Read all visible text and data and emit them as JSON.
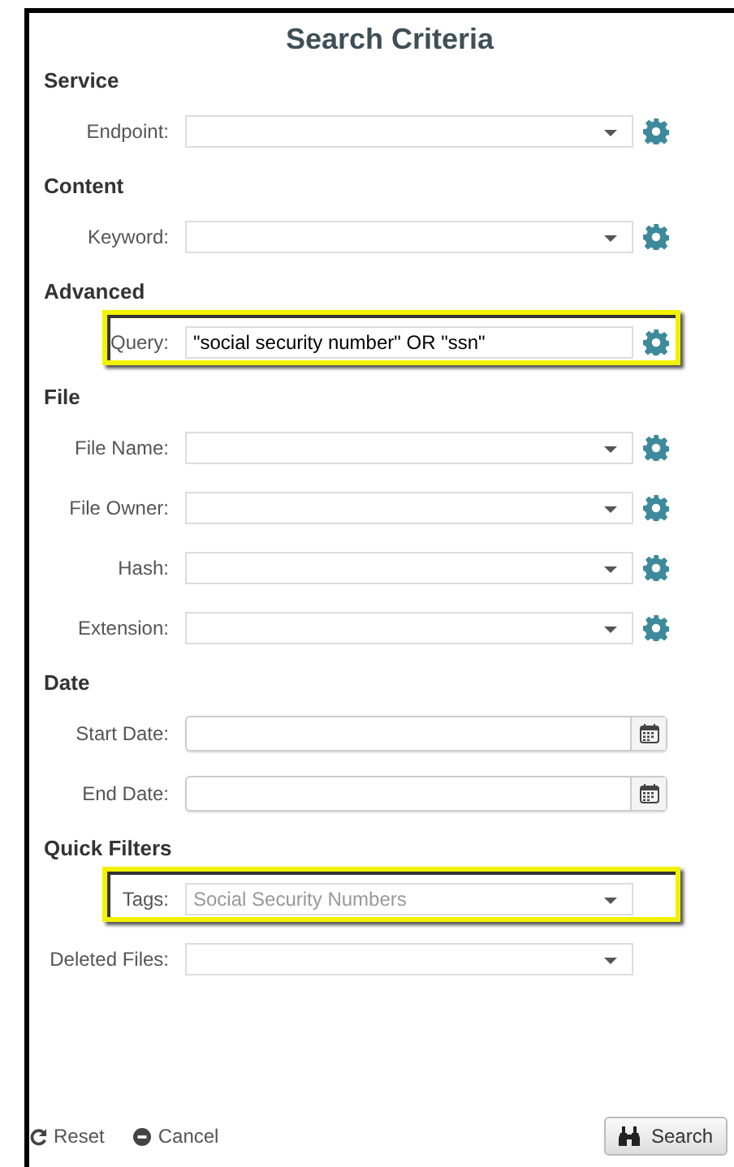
{
  "title": "Search Criteria",
  "sections": [
    {
      "heading": "Service",
      "fields": [
        {
          "kind": "combo",
          "label": "Endpoint:",
          "highlighted": false
        }
      ]
    },
    {
      "heading": "Content",
      "fields": [
        {
          "kind": "combo",
          "label": "Keyword:",
          "highlighted": false
        }
      ]
    },
    {
      "heading": "Advanced",
      "fields": [
        {
          "kind": "text",
          "label": "Query:",
          "value": "\"social security number\" OR \"ssn\"",
          "highlighted": true
        }
      ]
    },
    {
      "heading": "File",
      "fields": [
        {
          "kind": "combo",
          "label": "File Name:",
          "highlighted": false
        },
        {
          "kind": "combo",
          "label": "File Owner:",
          "highlighted": false
        },
        {
          "kind": "combo",
          "label": "Hash:",
          "highlighted": false
        },
        {
          "kind": "combo",
          "label": "Extension:",
          "highlighted": false
        }
      ]
    },
    {
      "heading": "Date",
      "fields": [
        {
          "kind": "date",
          "label": "Start Date:",
          "highlighted": false
        },
        {
          "kind": "date",
          "label": "End Date:",
          "highlighted": false
        }
      ]
    },
    {
      "heading": "Quick Filters",
      "fields": [
        {
          "kind": "select",
          "label": "Tags:",
          "placeholder": "Social Security Numbers",
          "highlighted": true
        },
        {
          "kind": "select",
          "label": "Deleted Files:",
          "highlighted": false
        }
      ]
    }
  ],
  "footer": {
    "reset": "Reset",
    "cancel": "Cancel",
    "search": "Search"
  }
}
